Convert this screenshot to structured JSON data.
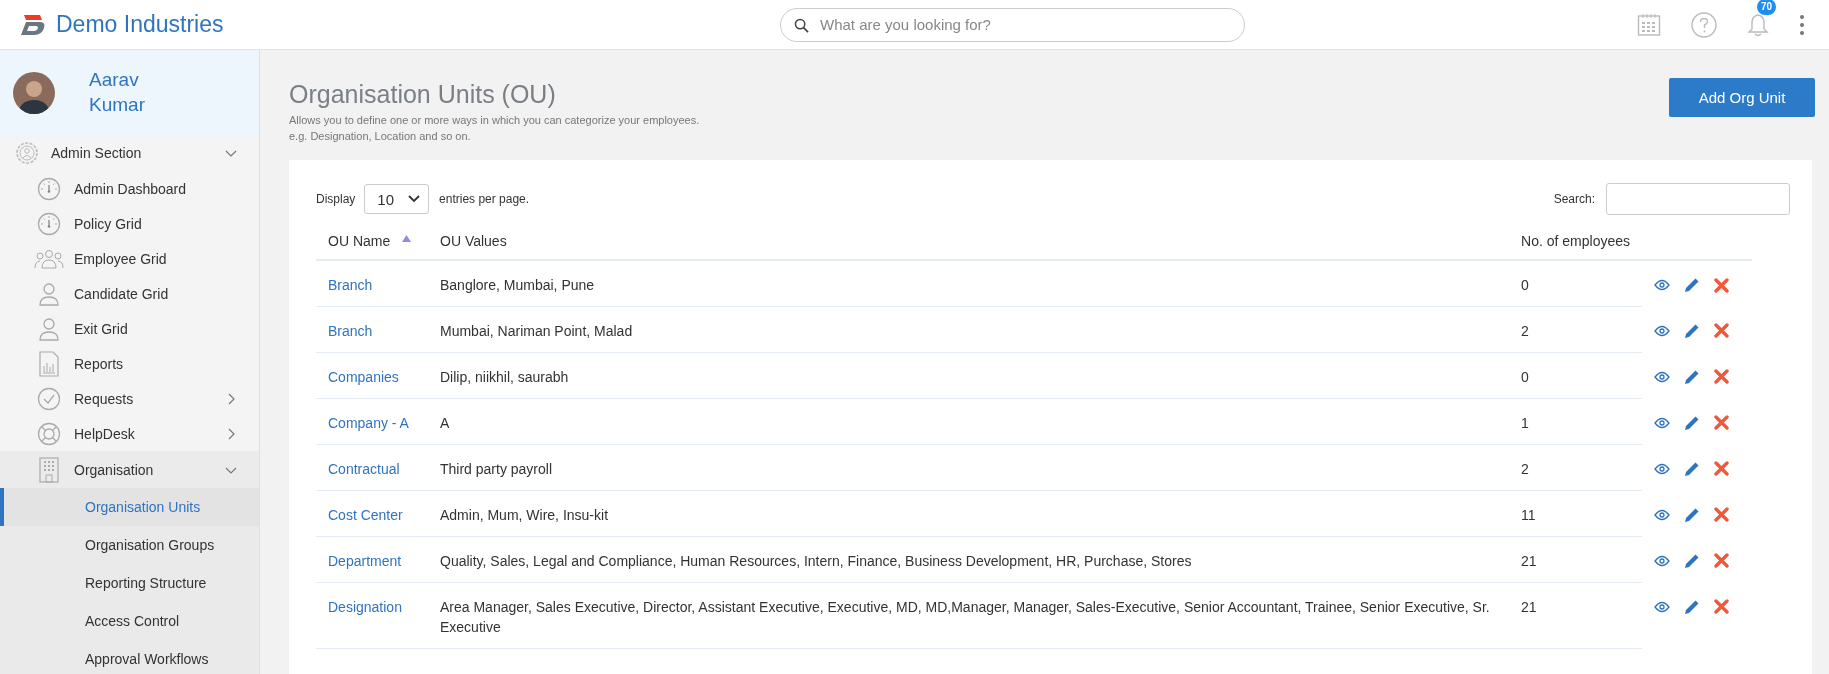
{
  "topbar": {
    "brand": "Demo Industries",
    "search": {
      "placeholder": "What are you looking for?"
    },
    "notifications": "70"
  },
  "sidebar": {
    "user": {
      "name": "Aarav Kumar"
    },
    "section": {
      "label": "Admin Section",
      "expanded": true,
      "items": [
        {
          "label": "Admin Dashboard"
        },
        {
          "label": "Policy Grid"
        },
        {
          "label": "Employee Grid"
        },
        {
          "label": "Candidate Grid"
        },
        {
          "label": "Exit Grid"
        },
        {
          "label": "Reports"
        },
        {
          "label": "Requests",
          "expanded": false
        },
        {
          "label": "HelpDesk",
          "expanded": false
        },
        {
          "label": "Organisation",
          "expanded": true,
          "children": [
            {
              "label": "Organisation Units",
              "selected": true
            },
            {
              "label": "Organisation Groups",
              "selected": false
            },
            {
              "label": "Reporting Structure",
              "selected": false
            },
            {
              "label": "Access Control",
              "selected": false
            },
            {
              "label": "Approval Workflows",
              "selected": false
            }
          ]
        }
      ]
    }
  },
  "page": {
    "title": "Organisation Units (OU)",
    "description": [
      "Allows you to define one or more ways in which you can categorize your employees.",
      "e.g. Designation, Location and so on."
    ],
    "add_button": "Add Org Unit"
  },
  "table": {
    "display_label": "Display",
    "page_size": "10",
    "per_page_label": "entries per page.",
    "search_label": "Search:",
    "columns": [
      {
        "label": "OU Name",
        "sorted": true
      },
      {
        "label": "OU Values",
        "sorted": false
      },
      {
        "label": "No. of employees",
        "sorted": false
      }
    ],
    "rows": [
      {
        "name": "Branch",
        "values": "Banglore, Mumbai, Pune",
        "count": "0"
      },
      {
        "name": "Branch",
        "values": "Mumbai, Nariman Point, Malad",
        "count": "2"
      },
      {
        "name": "Companies",
        "values": "Dilip, niikhil, saurabh",
        "count": "0"
      },
      {
        "name": "Company - A",
        "values": "A",
        "count": "1"
      },
      {
        "name": "Contractual",
        "values": "Third party payroll",
        "count": "2"
      },
      {
        "name": "Cost Center",
        "values": "Admin, Mum, Wire, Insu-kit",
        "count": "11"
      },
      {
        "name": "Department",
        "values": "Quality, Sales, Legal and Compliance, Human Resources, Intern, Finance, Business Development, HR, Purchase, Stores",
        "count": "21"
      },
      {
        "name": "Designation",
        "values": "Area Manager, Sales Executive, Director, Assistant Executive, Executive, MD, MD,Manager, Manager, Sales-Executive, Senior Accountant, Trainee, Senior Executive, Sr. Executive",
        "count": "21"
      }
    ]
  }
}
